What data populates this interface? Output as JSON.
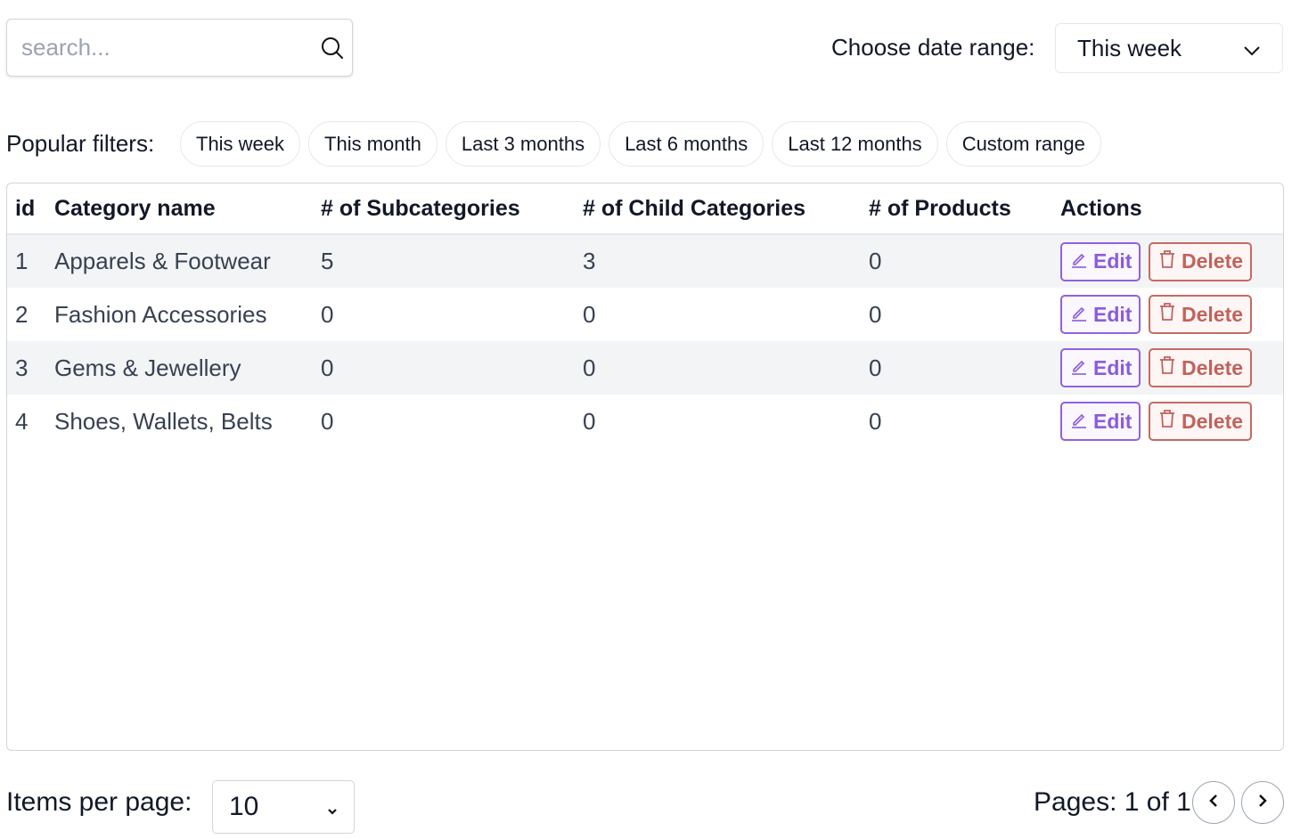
{
  "search": {
    "placeholder": "search...",
    "value": "",
    "icon": "search-icon"
  },
  "date_range": {
    "label": "Choose date range:",
    "selected": "This week",
    "icon": "chevron-down-icon"
  },
  "filters": {
    "label": "Popular filters:",
    "chips": [
      "This week",
      "This month",
      "Last 3 months",
      "Last 6 months",
      "Last 12 months",
      "Custom range"
    ]
  },
  "table": {
    "headers": [
      "id",
      "Category name",
      "# of Subcategories",
      "# of Child Categories",
      "# of Products",
      "Actions"
    ],
    "rows": [
      {
        "id": "1",
        "name": "Apparels & Footwear",
        "subcategories": "5",
        "child_categories": "3",
        "products": "0"
      },
      {
        "id": "2",
        "name": "Fashion Accessories",
        "subcategories": "0",
        "child_categories": "0",
        "products": "0"
      },
      {
        "id": "3",
        "name": "Gems & Jewellery",
        "subcategories": "0",
        "child_categories": "0",
        "products": "0"
      },
      {
        "id": "4",
        "name": "Shoes, Wallets, Belts",
        "subcategories": "0",
        "child_categories": "0",
        "products": "0"
      }
    ],
    "actions": {
      "edit_label": "Edit",
      "delete_label": "Delete"
    }
  },
  "pagination": {
    "items_per_page_label": "Items per page:",
    "items_per_page": "10",
    "pages_text": "Pages: 1 of 1"
  },
  "colors": {
    "edit": "#8a5cdb",
    "delete": "#c2625b",
    "row_stripe": "#f3f4f6"
  }
}
